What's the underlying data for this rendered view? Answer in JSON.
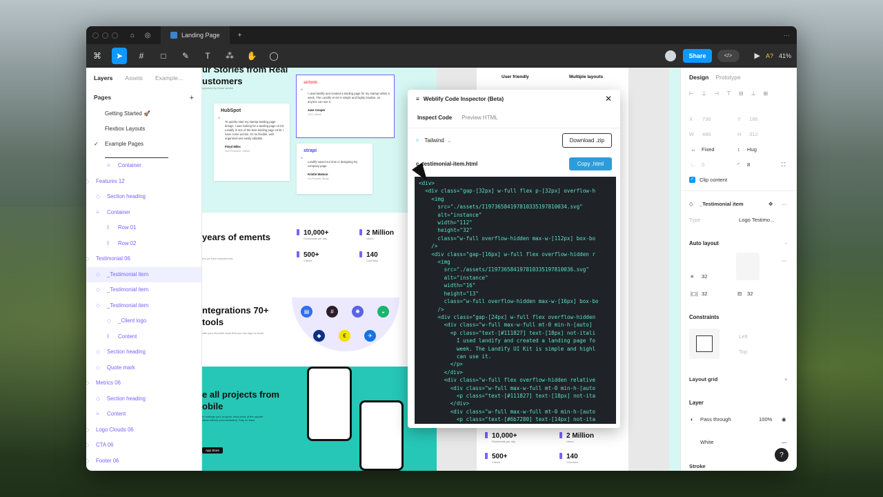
{
  "window": {
    "tab_title": "Landing Page"
  },
  "toolbar": {
    "share": "Share",
    "zoom": "41%",
    "dev": "</>"
  },
  "left_panel": {
    "tabs": [
      "Layers",
      "Assets",
      "Example..."
    ],
    "pages_heading": "Pages",
    "pages": [
      "Getting Started 🚀",
      "Flexbox Layouts",
      "Example Pages"
    ],
    "layers": [
      "Container",
      "Features 12",
      "Section heading",
      "Container",
      "Row 01",
      "Row 02",
      "Testimonial 06",
      "_Testimonial item",
      "_Testimonial item",
      "_Testimonial item",
      "_Client logo",
      "Content",
      "Section heading",
      "Quote mark",
      "Metrics 06",
      "Section heading",
      "Content",
      "Logo Clouds 06",
      "CTA 06",
      "Footer 06"
    ]
  },
  "canvas": {
    "heading1": "ur Stories from Real ustomers",
    "sub1": "upported by these stories.",
    "card1": {
      "logo": "HubSpot",
      "text": "To quickly start my startup landing page design, I was looking for a landing page UI Kit. Landify is one of the best landing page UI kit I have come across. It's so flexible, well organised and easily editable.",
      "name": "Floyd Miles",
      "role": "Vice President, GitHub"
    },
    "card2": {
      "logo": "airbnb",
      "text": "I used landify and created a landing page for my startup within a week. The Landify UI Kit is simple and highly intuitive, so anyone can use it.",
      "name": "Jane Cooper",
      "role": "CEO, Airbnb"
    },
    "card3": {
      "logo": "strapi",
      "text": "Landify saved our time in designing my company page.",
      "name": "Kristin Watson",
      "role": "Co-Founder, Strapi"
    },
    "heading2": "years of ements",
    "sub2": "ers we have reached this",
    "stats": [
      {
        "v": "10,000+",
        "l": "Downloads per day"
      },
      {
        "v": "2 Million",
        "l": "Users"
      },
      {
        "v": "500+",
        "l": "Clients"
      },
      {
        "v": "140",
        "l": "Countries"
      }
    ],
    "heading3": "ntegrations 70+ tools",
    "sub3": "with your favourite tools that you use ings on track.",
    "heading4": "e all projects from obile",
    "sub4": "to manage your projects, keep track of the update ideas without procrastinating. Stay on track.",
    "appstore": "App Store",
    "features": [
      "User friendly",
      "Multiple layouts"
    ],
    "stats2": [
      {
        "v": "10,000+",
        "l": "Downloads per day"
      },
      {
        "v": "2 Million",
        "l": "Users"
      },
      {
        "v": "500+",
        "l": "Clients"
      },
      {
        "v": "140",
        "l": "Countries"
      }
    ]
  },
  "inspector": {
    "title": "Weblify Code Inspector (Beta)",
    "tabs": [
      "Inspect Code",
      "Preview HTML"
    ],
    "framework": "Tailwind",
    "download": "Download .zip",
    "filename": "c_testimonial-item.html",
    "copy": "Copy .html",
    "code": "<div>\n  <div class=\"gap-[32px] w-full flex p-[32px] overflow-h\n    <img\n      src=\"./assets/I1973658419781033519781003​4.svg\"\n      alt=\"instance\"\n      width=\"112\"\n      height=\"32\"\n      class=\"w-full overflow-hidden max-w-[112px] box-bo\n    />\n    <div class=\"gap-[16px] w-full flex overflow-hidden r\n      <img\n        src=\"./assets/I19736584197810335197810036.svg\"\n        alt=\"instance\"\n        width=\"16\"\n        height=\"13\"\n        class=\"w-full overflow-hidden max-w-[16px] box-bo\n      />\n      <div class=\"gap-[24px] w-full flex overflow-hidden\n        <div class=\"w-full max-w-full mt-0 min-h-[auto] \n          <p class=\"text-[#111827] text-[18px] not-itali\n            I used landify and created a landing page fo\n            week. The Landify UI Kit is simple and highl\n            can use it.\n          </p>\n        </div>\n        <div class=\"w-full flex overflow-hidden relative\n          <div class=\"w-full max-w-full mt-0 min-h-[auto\n            <p class=\"text-[#111827] text-[18px] not-ita\n          </div>\n          <div class=\"w-full max-w-full mt-0 min-h-[auto\n            <p class=\"text-[#6b7280] text-[14px] not-ita"
  },
  "right_panel": {
    "tabs": [
      "Design",
      "Prototype"
    ],
    "x": "736",
    "y": "186",
    "w": "486",
    "h": "312",
    "fixed": "Fixed",
    "hug": "Hug",
    "radius": "0",
    "corner": "8",
    "clip": "Clip content",
    "component": "_Testimonial item",
    "type_label": "Type",
    "type_value": "Logo Testimo...",
    "auto_layout": "Auto layout",
    "gap": "32",
    "pad_h": "32",
    "pad_v": "32",
    "constraints": "Constraints",
    "left": "Left",
    "top": "Top",
    "layout_grid": "Layout grid",
    "layer": "Layer",
    "blend": "Pass through",
    "opacity": "100%",
    "fill": "White",
    "stroke": "Stroke"
  },
  "help": "?"
}
